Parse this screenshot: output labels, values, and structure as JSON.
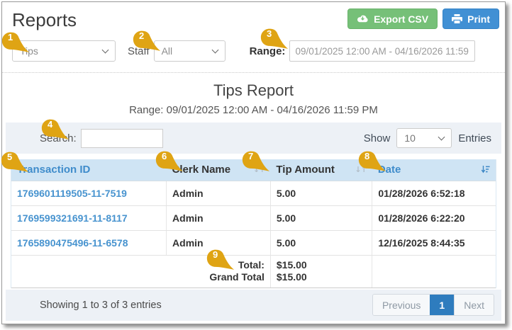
{
  "page": {
    "title": "Reports"
  },
  "toolbar": {
    "export_csv_label": "Export CSV",
    "print_label": "Print"
  },
  "filters": {
    "report_type_value": "Tips",
    "staff_label": "Staff",
    "staff_value": "All",
    "range_label": "Range:",
    "range_value": "09/01/2025 12:00 AM - 04/16/2026 11:59 PM"
  },
  "report": {
    "title": "Tips Report",
    "subtitle": "Range: 09/01/2025 12:00 AM - 04/16/2026 11:59 PM"
  },
  "table_controls": {
    "search_label": "Search:",
    "search_value": "",
    "show_label": "Show",
    "entries_per_page": "10",
    "entries_label": "Entries"
  },
  "table": {
    "columns": [
      {
        "label": "Transaction ID",
        "sort_state": "none"
      },
      {
        "label": "Clerk Name",
        "sort_state": "unsorted"
      },
      {
        "label": "Tip Amount",
        "sort_state": "unsorted"
      },
      {
        "label": "Date",
        "sort_state": "descending"
      }
    ],
    "rows": [
      {
        "transaction_id": "1769601119505-11-7519",
        "clerk_name": "Admin",
        "tip_amount": "5.00",
        "date": "01/28/2026 6:52:18"
      },
      {
        "transaction_id": "1769599321691-11-8117",
        "clerk_name": "Admin",
        "tip_amount": "5.00",
        "date": "01/28/2026 6:22:20"
      },
      {
        "transaction_id": "1765890475496-11-6578",
        "clerk_name": "Admin",
        "tip_amount": "5.00",
        "date": "12/16/2025 8:44:35"
      }
    ],
    "footer": {
      "total_label": "Total:",
      "grand_total_label": "Grand Total",
      "total_value": "$15.00",
      "grand_total_value": "$15.00"
    }
  },
  "pagination": {
    "summary": "Showing 1 to 3 of 3 entries",
    "previous_label": "Previous",
    "current_page": "1",
    "next_label": "Next"
  },
  "callouts": [
    "1",
    "2",
    "3",
    "4",
    "5",
    "6",
    "7",
    "8",
    "9"
  ],
  "colors": {
    "callout_marker": "#dfa414",
    "export_button": "#76c078",
    "print_button": "#4190d4",
    "link_blue": "#3f8ccb",
    "table_header_bg": "#cfe4f4",
    "band_bg": "#edf1f6",
    "active_page_bg": "#2e7cbe"
  }
}
